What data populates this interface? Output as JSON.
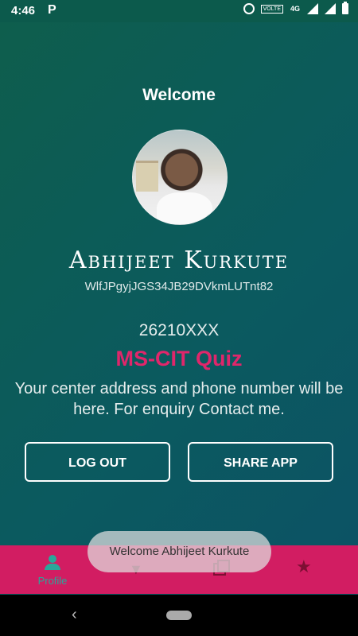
{
  "status_bar": {
    "time": "4:46",
    "app_icon": "P",
    "volte": "VOLTE",
    "network": "4G",
    "icons": [
      "alarm-icon",
      "volte-icon",
      "lte-icon",
      "signal-icon",
      "signal-icon",
      "battery-icon"
    ]
  },
  "profile": {
    "welcome": "Welcome",
    "name": "Abhijeet Kurkute",
    "user_id": "WlfJPgyjJGS34JB29DVkmLUTnt82",
    "center_code": "26210XXX",
    "app_title": "MS-CIT Quiz",
    "center_info": "Your center address and phone number will be here. For enquiry Contact me."
  },
  "actions": {
    "logout_label": "LOG OUT",
    "share_label": "SHARE APP"
  },
  "bottom_nav": {
    "items": [
      {
        "label": "Profile",
        "icon": "person-icon",
        "active": true
      },
      {
        "label": "",
        "icon": "wifi-off-icon",
        "active": false
      },
      {
        "label": "",
        "icon": "library-icon",
        "active": false
      },
      {
        "label": "",
        "icon": "star-icon",
        "active": false
      }
    ]
  },
  "toast": {
    "message": "Welcome Abhijeet Kurkute"
  },
  "colors": {
    "accent": "#d21d62",
    "title_pink": "#e0266b",
    "nav_active": "#2aa79a",
    "background_start": "#0e5e4c",
    "background_end": "#0c5166"
  }
}
